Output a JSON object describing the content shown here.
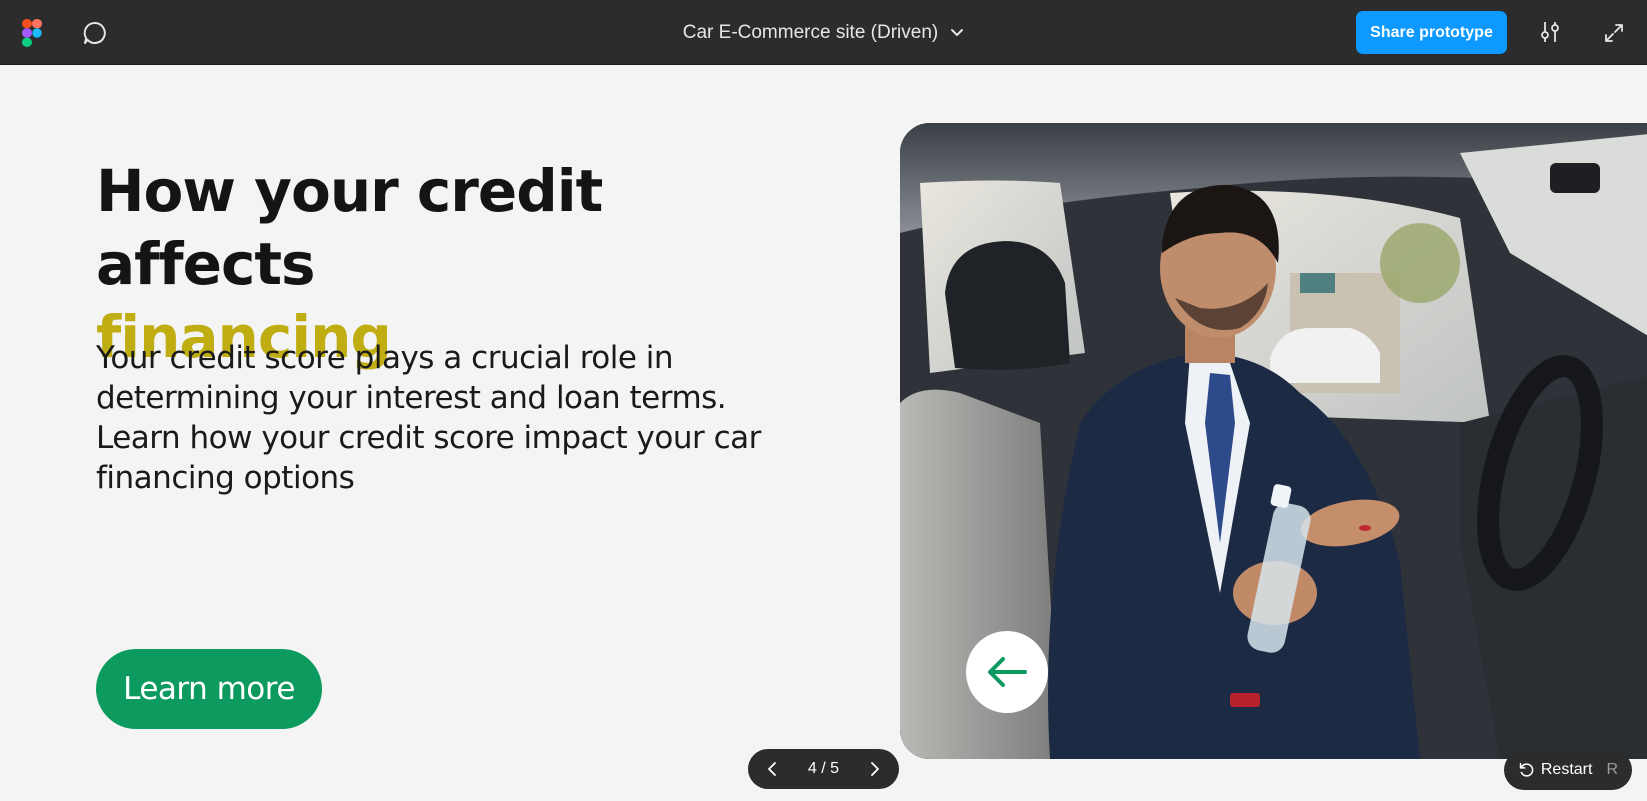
{
  "toolbar": {
    "file_title": "Car E-Commerce site (Driven)",
    "share_label": "Share prototype"
  },
  "slide": {
    "headline_line1": "How your credit affects",
    "headline_accent": "financing",
    "body": "Your credit score plays a crucial role in determining your interest and loan terms. Learn how your credit score impact your car financing options",
    "cta_label": "Learn more"
  },
  "pager": {
    "position": "4 / 5"
  },
  "restart": {
    "label": "Restart",
    "shortcut": "R"
  },
  "colors": {
    "toolbar_bg": "#2c2c2c",
    "share_blue": "#0d99ff",
    "accent_yellow": "#c0ad12",
    "cta_green": "#0c9a5e",
    "page_bg": "#f4f4f4"
  },
  "icons": {
    "logo": "figma-logo-icon",
    "comment": "comment-bubble-icon",
    "title_dropdown": "chevron-down-icon",
    "settings": "sliders-icon",
    "expand": "expand-icon",
    "photo_nav": "arrow-left-icon",
    "pager_prev": "chevron-left-icon",
    "pager_next": "chevron-right-icon",
    "restart": "restart-icon"
  }
}
